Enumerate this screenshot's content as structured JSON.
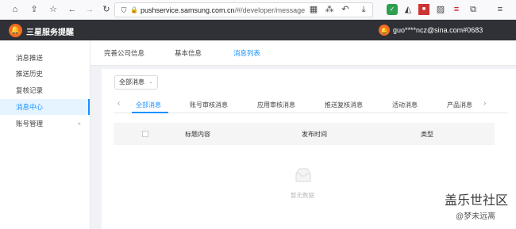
{
  "browser": {
    "url_host": "pushservice.samsung.com.cn",
    "url_path": "/#/developer/message"
  },
  "header": {
    "app_title": "三星服务提醒",
    "user": "guo****ncz@sina.com#0683"
  },
  "sidebar": {
    "items": [
      {
        "label": "消息推送"
      },
      {
        "label": "推送历史"
      },
      {
        "label": "复核记录"
      },
      {
        "label": "消息中心"
      },
      {
        "label": "账号管理"
      }
    ]
  },
  "top_tabs": [
    {
      "label": "完善公司信息"
    },
    {
      "label": "基本信息"
    },
    {
      "label": "消息列表"
    }
  ],
  "filter": {
    "selected": "全部消息"
  },
  "message_tabs": [
    {
      "label": "全部消息"
    },
    {
      "label": "账号审核消息"
    },
    {
      "label": "应用审核消息"
    },
    {
      "label": "推送复核消息"
    },
    {
      "label": "活动消息"
    },
    {
      "label": "产品消息"
    }
  ],
  "table": {
    "columns": [
      "标题内容",
      "发布时间",
      "类型"
    ],
    "empty_text": "暂无数据"
  },
  "watermark": {
    "line1": "盖乐世社区",
    "line2": "@梦未远离"
  },
  "colors": {
    "accent": "#1890ff",
    "brand": "#f46b22",
    "header_bg": "#2f3137"
  }
}
